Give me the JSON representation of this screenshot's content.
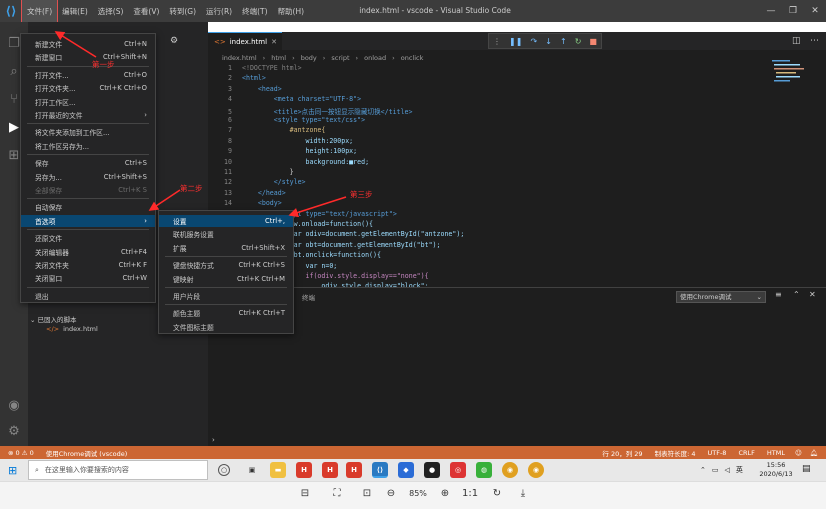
{
  "titlebar": {
    "title": "index.html - vscode - Visual Studio Code",
    "menus": [
      "文件(F)",
      "编辑(E)",
      "选择(S)",
      "查看(V)",
      "转到(G)",
      "运行(R)",
      "终端(T)",
      "帮助(H)"
    ]
  },
  "editor": {
    "tab": "index.html",
    "breadcrumb": [
      "index.html",
      "html",
      "body",
      "script",
      "onload",
      "onclick"
    ],
    "lines": [
      {
        "n": "1",
        "t": "<!DOCTYPE html>"
      },
      {
        "n": "2",
        "t": "<html>"
      },
      {
        "n": "3",
        "t": "    <head>"
      },
      {
        "n": "4",
        "t": "        <meta charset=\"UTF-8\">"
      },
      {
        "n": "5",
        "t": "        <title>点击同一按钮显示隐藏切换</title>"
      },
      {
        "n": "6",
        "t": "        <style type=\"text/css\">"
      },
      {
        "n": "7",
        "t": "            #antzone{"
      },
      {
        "n": "8",
        "t": "                width:200px;"
      },
      {
        "n": "9",
        "t": "                height:100px;"
      },
      {
        "n": "10",
        "t": "                background:■red;"
      },
      {
        "n": "11",
        "t": "            }"
      },
      {
        "n": "12",
        "t": "        </style>"
      },
      {
        "n": "13",
        "t": "    </head>"
      },
      {
        "n": "14",
        "t": "    <body>"
      },
      {
        "n": "",
        "t": "        <script type=\"text/javascript\">"
      },
      {
        "n": "",
        "t": "        window.onload=function(){"
      },
      {
        "n": "",
        "t": "            var odiv=document.getElementById(\"antzone\");"
      },
      {
        "n": "",
        "t": "            var obt=document.getElementById(\"bt\");"
      },
      {
        "n": "",
        "t": "            obt.onclick=function(){"
      },
      {
        "n": "",
        "t": "                var n=0;"
      },
      {
        "n": "",
        "t": "                if(odiv.style.display==\"none\"){"
      },
      {
        "n": "",
        "t": "                    odiv.style.display=\"block\";"
      }
    ]
  },
  "panel": {
    "tab": "终端",
    "select": "使用Chrome调试"
  },
  "explorer": {
    "open_editors": "已固入的脚本",
    "file": "index.html"
  },
  "file_menu": [
    {
      "label": "新建文件",
      "key": "Ctrl+N"
    },
    {
      "label": "新建窗口",
      "key": "Ctrl+Shift+N"
    },
    {
      "label": "打开文件...",
      "key": "Ctrl+O"
    },
    {
      "label": "打开文件夹...",
      "key": "Ctrl+K Ctrl+O"
    },
    {
      "label": "打开工作区...",
      "key": ""
    },
    {
      "label": "打开最近的文件",
      "key": "›"
    },
    {
      "label": "将文件夹添加到工作区...",
      "key": ""
    },
    {
      "label": "将工作区另存为...",
      "key": ""
    },
    {
      "label": "保存",
      "key": "Ctrl+S"
    },
    {
      "label": "另存为...",
      "key": "Ctrl+Shift+S"
    },
    {
      "label": "全部保存",
      "key": "Ctrl+K S"
    },
    {
      "label": "自动保存",
      "key": ""
    },
    {
      "label": "首选项",
      "key": "›"
    },
    {
      "label": "还原文件",
      "key": ""
    },
    {
      "label": "关闭编辑器",
      "key": "Ctrl+F4"
    },
    {
      "label": "关闭文件夹",
      "key": "Ctrl+K F"
    },
    {
      "label": "关闭窗口",
      "key": "Ctrl+W"
    },
    {
      "label": "退出",
      "key": ""
    }
  ],
  "pref_menu": [
    {
      "label": "设置",
      "key": "Ctrl+,"
    },
    {
      "label": "联机服务设置",
      "key": ""
    },
    {
      "label": "扩展",
      "key": "Ctrl+Shift+X"
    },
    {
      "label": "键盘快捷方式",
      "key": "Ctrl+K Ctrl+S"
    },
    {
      "label": "键映射",
      "key": "Ctrl+K Ctrl+M"
    },
    {
      "label": "用户片段",
      "key": ""
    },
    {
      "label": "颜色主题",
      "key": "Ctrl+K Ctrl+T"
    },
    {
      "label": "文件图标主题",
      "key": ""
    }
  ],
  "annotations": {
    "step1": "第一步",
    "step2": "第二步",
    "step3": "第三步"
  },
  "statusbar": {
    "errors": "⊗ 0  ⚠ 0",
    "debug": "使用Chrome调试 (vscode)",
    "position": "行 20，列 29",
    "indent": "制表符长度: 4",
    "encoding": "UTF-8",
    "eol": "CRLF",
    "lang": "HTML"
  },
  "taskbar": {
    "search_placeholder": "在这里输入你要搜索的内容",
    "ime": "英",
    "time": "15:56",
    "date": "2020/6/13"
  },
  "viewer": {
    "zoom": "85%"
  },
  "colors": {
    "statusbar": "#cc6633",
    "highlight": "#094771",
    "annotation": "#ff3030"
  }
}
